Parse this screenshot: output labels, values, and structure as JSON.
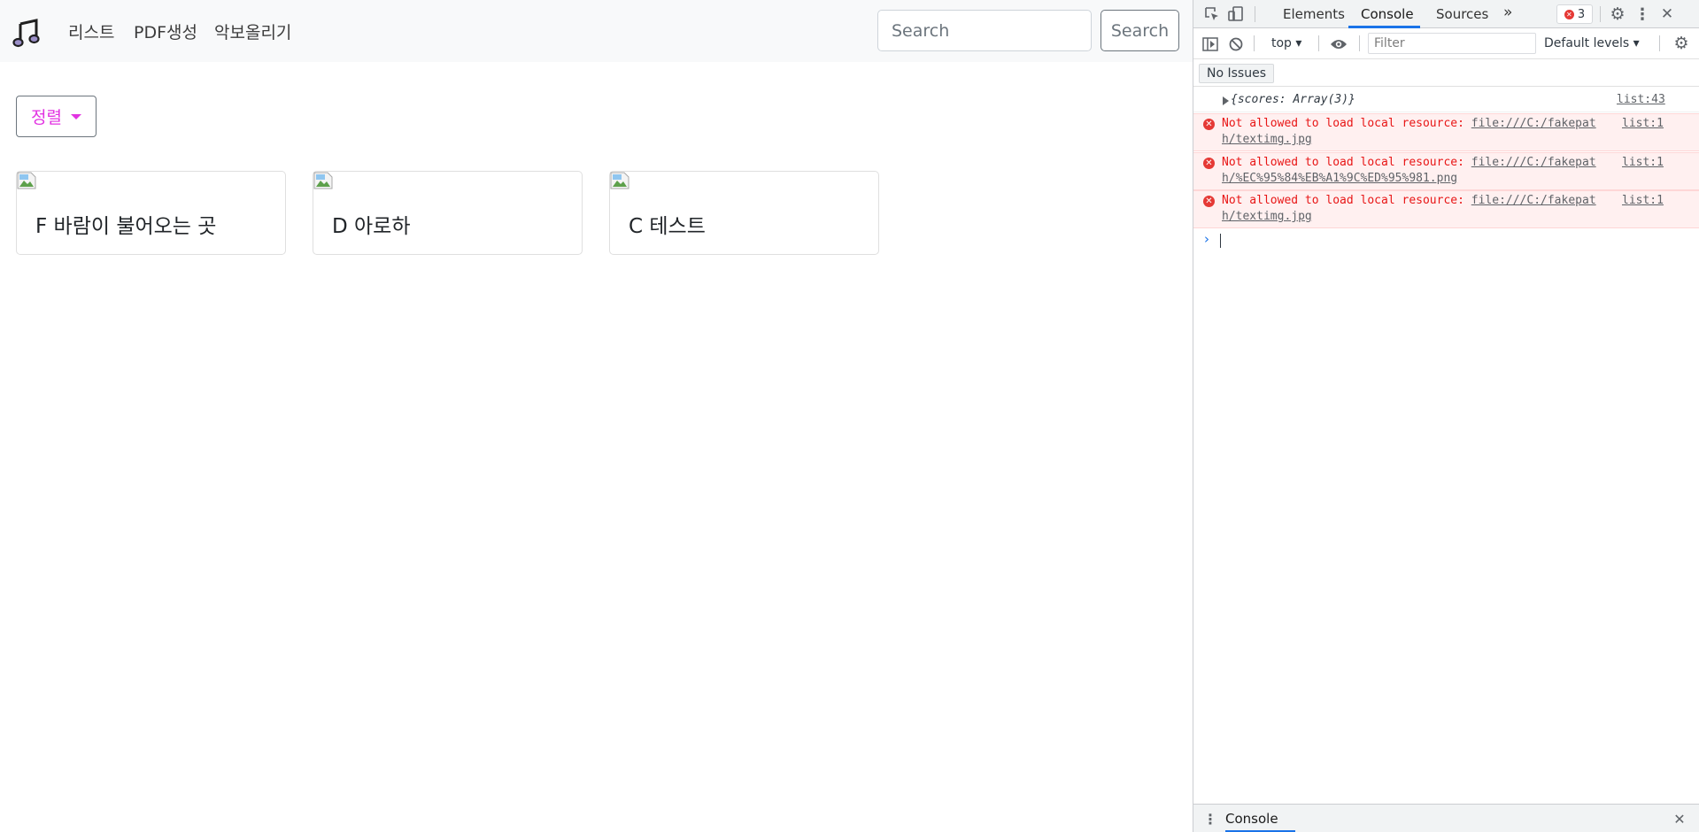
{
  "navbar": {
    "brand_icon": "music-note-icon",
    "links": [
      "리스트",
      "PDF생성",
      "악보올리기"
    ],
    "search_placeholder": "Search",
    "search_button": "Search"
  },
  "sort": {
    "label": "정렬",
    "accent": "#e233e2"
  },
  "cards": [
    {
      "title": "F 바람이 불어오는 곳",
      "image": "broken-image-icon"
    },
    {
      "title": "D 아로하",
      "image": "broken-image-icon"
    },
    {
      "title": "C 테스트",
      "image": "broken-image-icon"
    }
  ],
  "devtools": {
    "tabs": [
      "Elements",
      "Console",
      "Sources"
    ],
    "active_tab": "Console",
    "more_tabs": "»",
    "error_count": "3",
    "context": "top",
    "filter_placeholder": "Filter",
    "levels": "Default levels",
    "issues_label": "No Issues",
    "log": {
      "object_text": "{scores: Array(3)}",
      "object_source": "list:43"
    },
    "errors": [
      {
        "message": "Not allowed to load local resource:",
        "url": "file:///C:/fakepat",
        "url_cont": "h/textimg.jpg",
        "source": "list:1"
      },
      {
        "message": "Not allowed to load local resource:",
        "url": "file:///C:/fakepat",
        "url_cont": "h/%EC%95%84%EB%A1%9C%ED%95%981.png",
        "source": "list:1"
      },
      {
        "message": "Not allowed to load local resource:",
        "url": "file:///C:/fakepat",
        "url_cont": "h/textimg.jpg",
        "source": "list:1"
      }
    ],
    "prompt_symbol": "›",
    "drawer_tab": "Console",
    "colors": {
      "accent_blue": "#1a73e8",
      "error_red": "#e81616",
      "error_bg": "#fff0f0"
    }
  }
}
